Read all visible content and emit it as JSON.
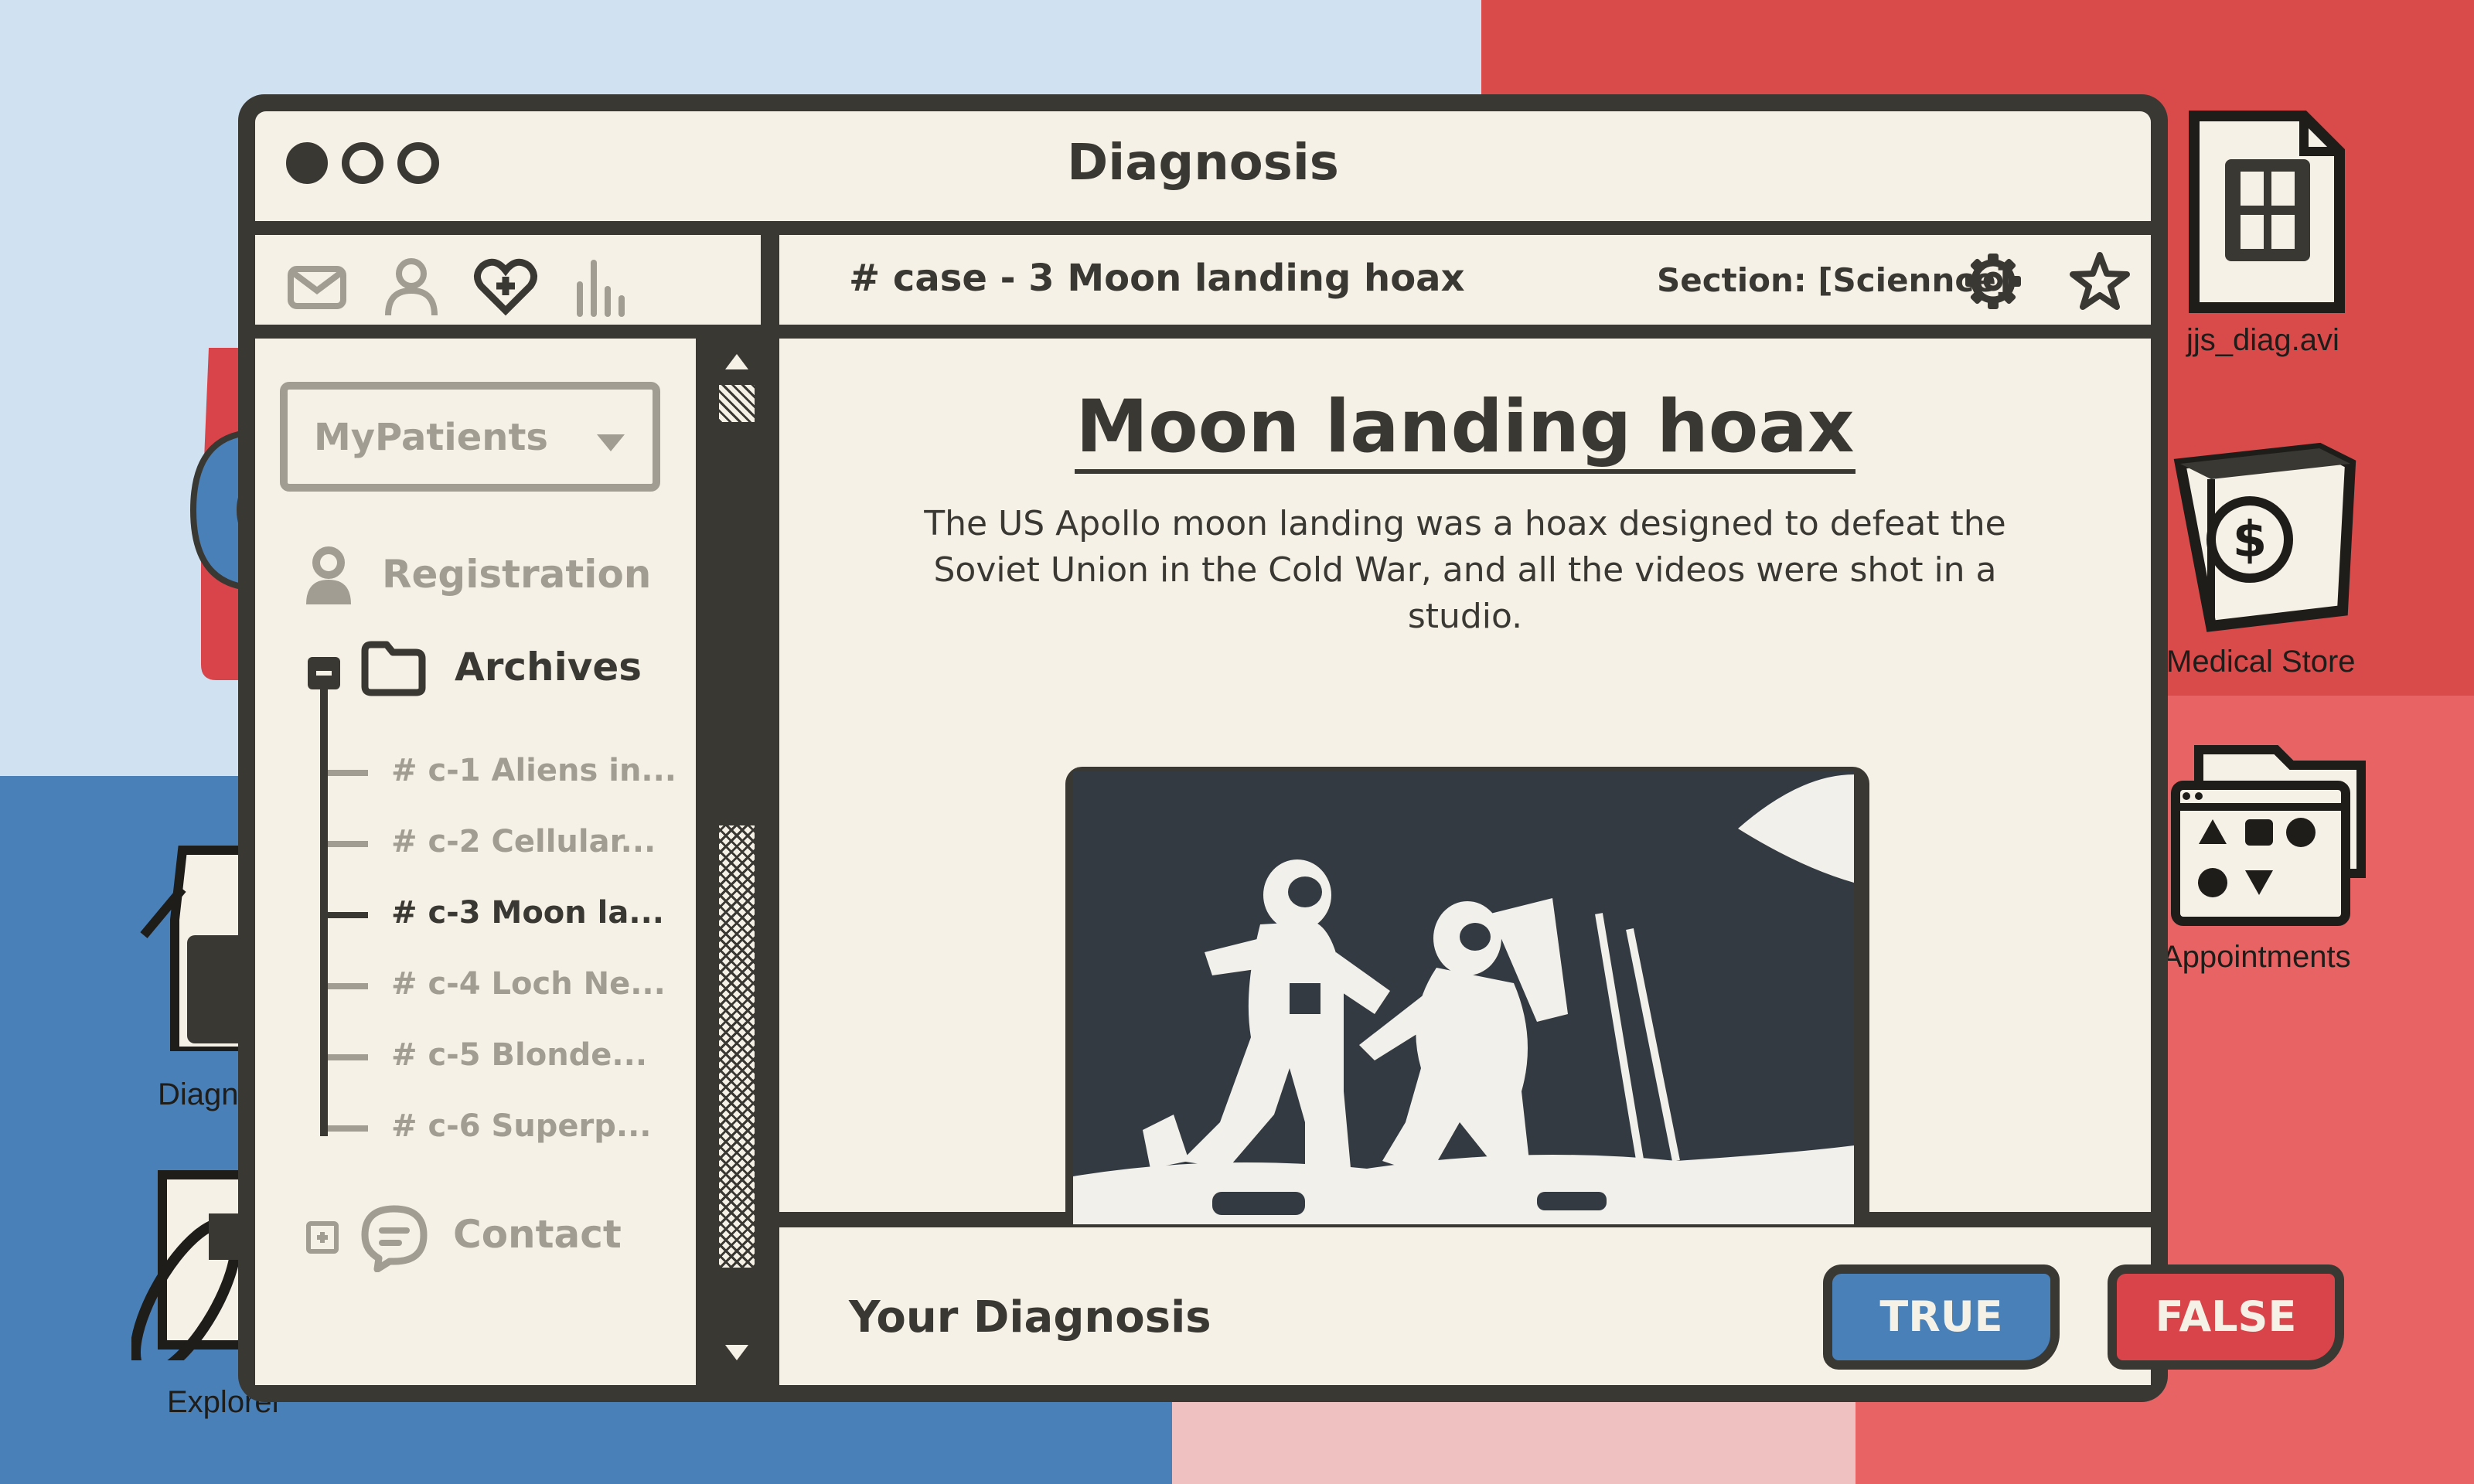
{
  "window": {
    "title": "Diagnosis"
  },
  "header": {
    "case_title": "# case - 3 Moon landing hoax",
    "section_label": "Section: [Sciennce]"
  },
  "article": {
    "title": "Moon landing hoax",
    "body": "The US Apollo moon landing was a hoax designed to defeat the Soviet Union in the Cold War, and all the videos were shot in a studio."
  },
  "sidebar": {
    "dropdown_value": "MyPatients",
    "registration": "Registration",
    "archives": "Archives",
    "cases": [
      {
        "label": "# c-1 Aliens in...",
        "active": false
      },
      {
        "label": "# c-2 Cellular...",
        "active": false
      },
      {
        "label": "# c-3 Moon la...",
        "active": true
      },
      {
        "label": "# c-4 Loch Ne...",
        "active": false
      },
      {
        "label": "# c-5 Blonde...",
        "active": false
      },
      {
        "label": "# c-6 Superp...",
        "active": false
      }
    ],
    "contact": "Contact"
  },
  "footer": {
    "label": "Your Diagnosis",
    "true_label": "TRUE",
    "false_label": "FALSE"
  },
  "desktop": {
    "icons": [
      {
        "label": "jjs_diag.avi",
        "icon": "video-file-icon"
      },
      {
        "label": "Medical Store",
        "icon": "store-icon"
      },
      {
        "label": "Appointments",
        "icon": "appointments-folder-icon"
      },
      {
        "label": "Diagn",
        "icon": "diagnosis-app-icon"
      },
      {
        "label": "Explorer",
        "icon": "explorer-icon"
      }
    ]
  },
  "colors": {
    "ink": "#3a3833",
    "paper": "#f6f1e6",
    "muted": "#a19d93",
    "true_blue": "#4a80b8",
    "false_red": "#d9444a",
    "bg_light_blue": "#d0e1f1",
    "bg_red": "#d94a4b",
    "bg_blue": "#4a80b8",
    "bg_pink": "#f0c1c1",
    "bg_coral": "#e86464"
  }
}
